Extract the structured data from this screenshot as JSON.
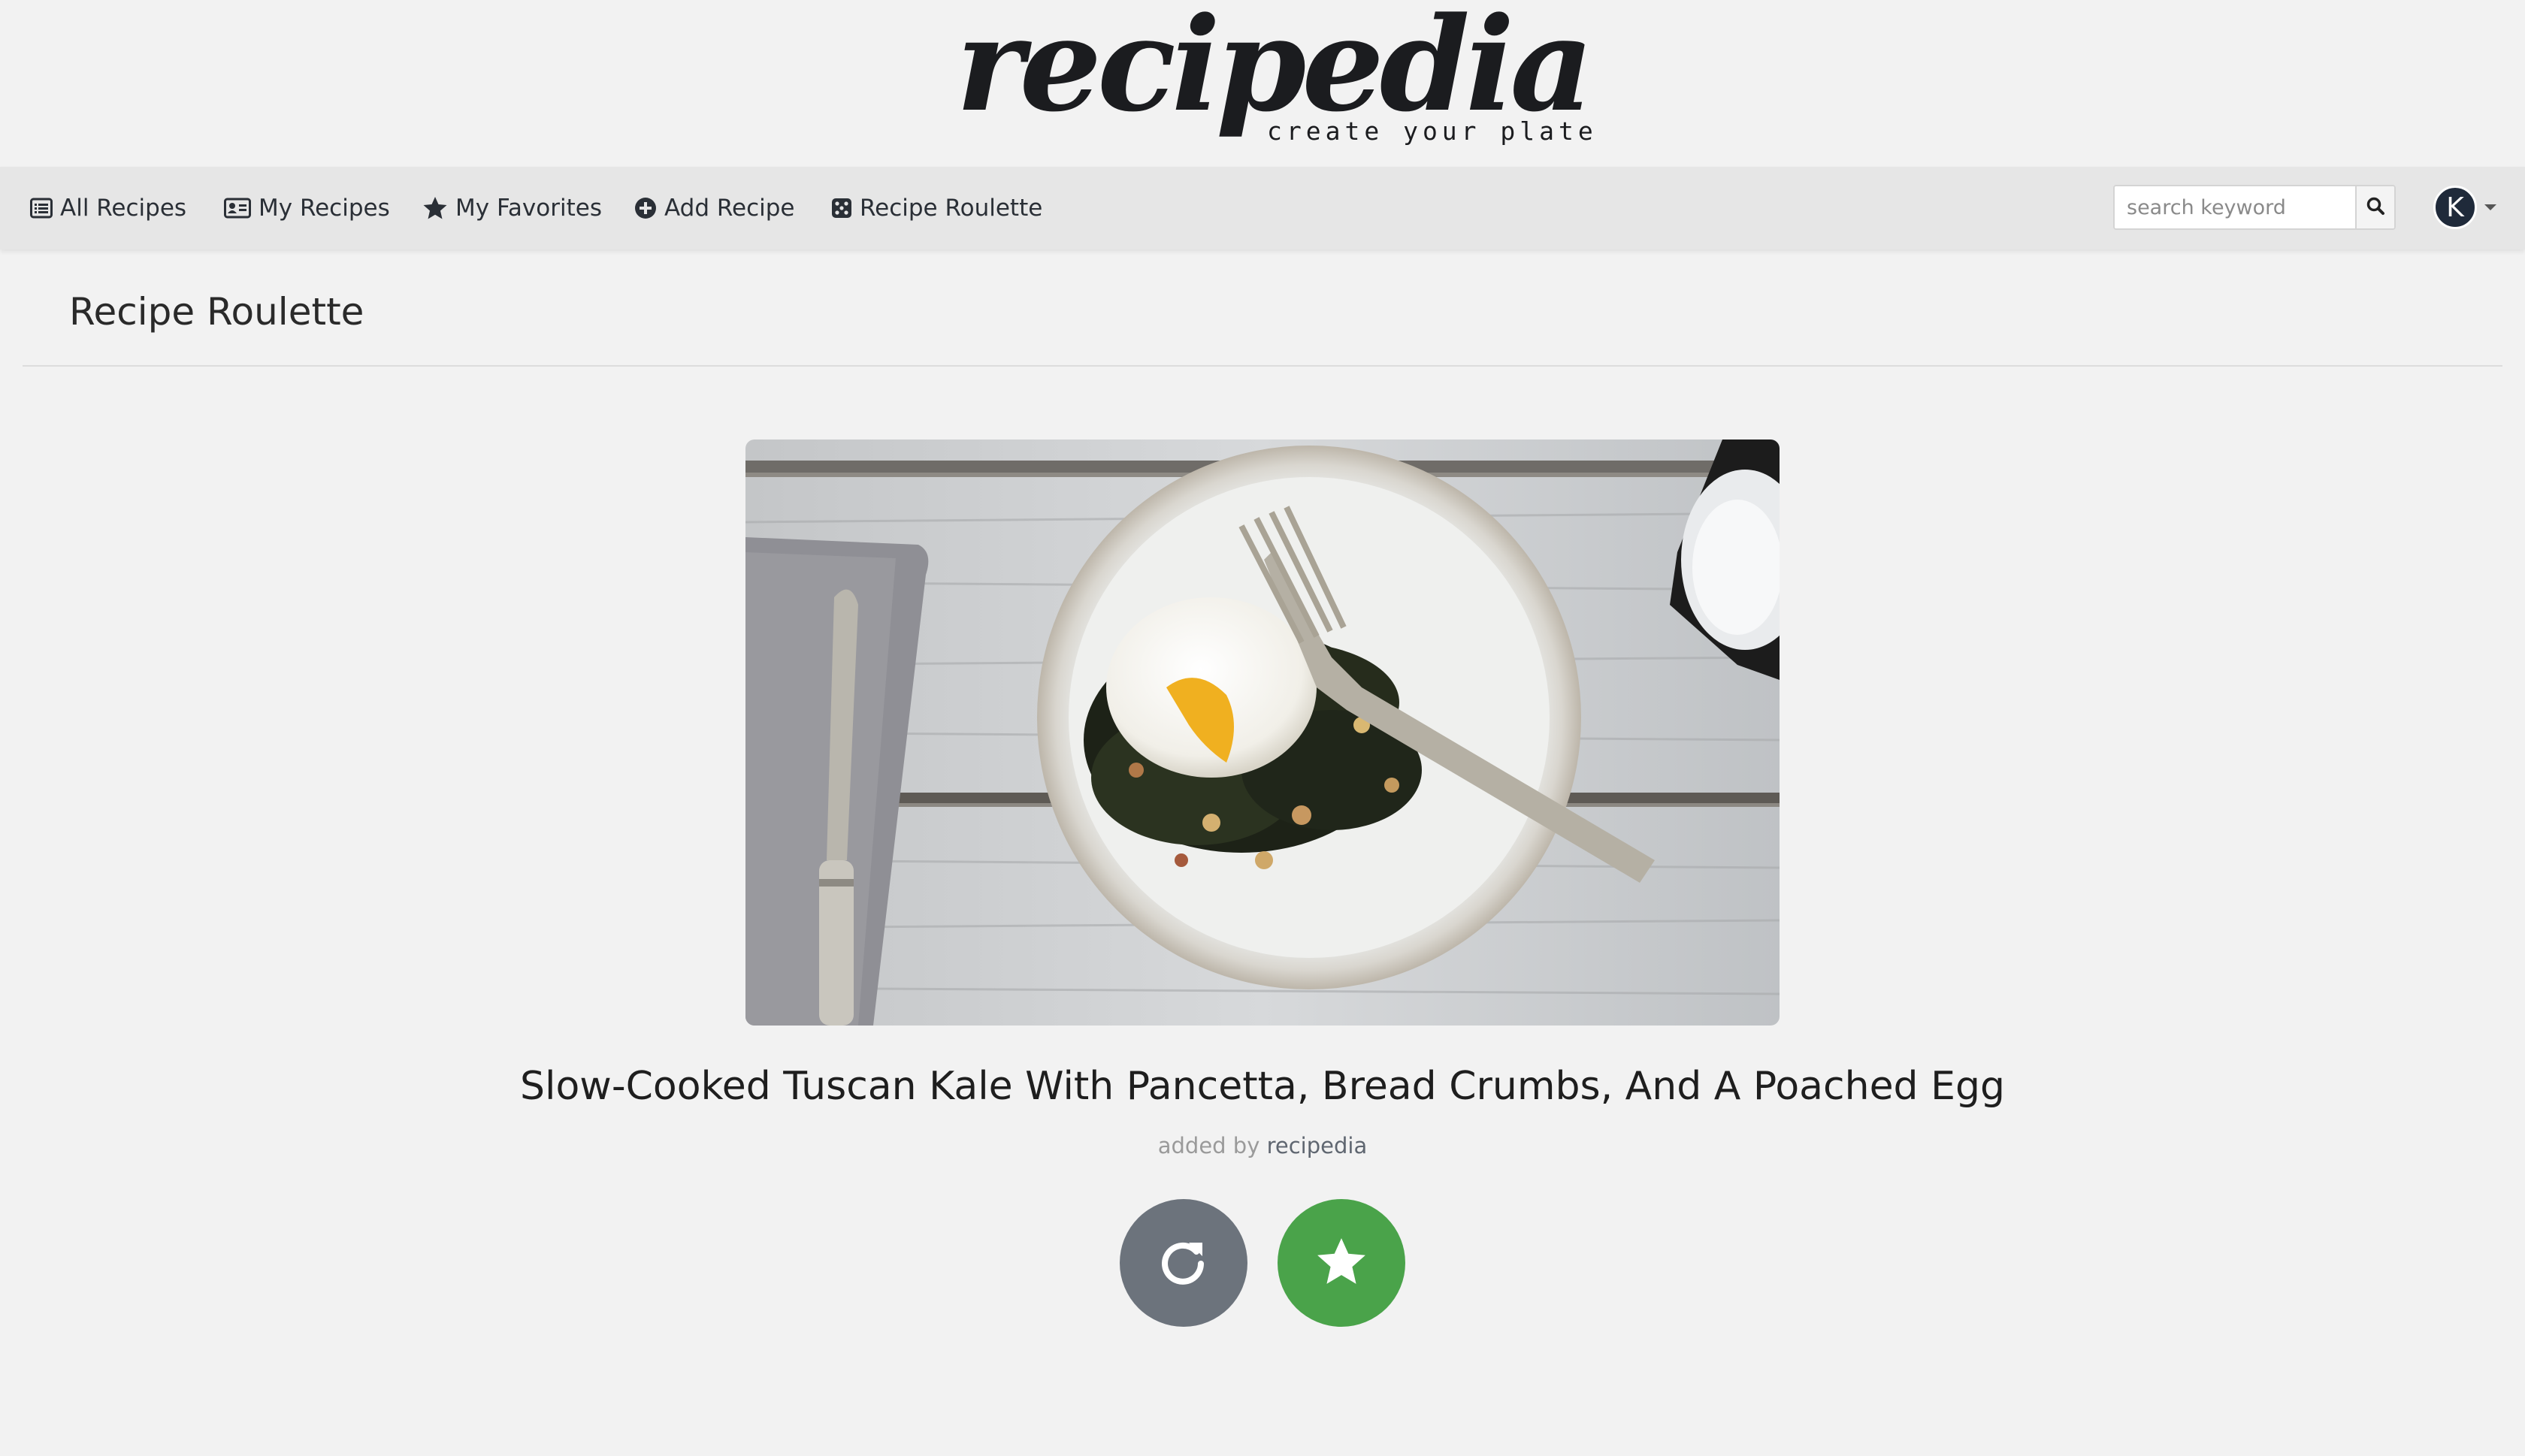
{
  "brand": {
    "logo_text": "recipedia",
    "tagline": "create your plate"
  },
  "nav": {
    "items": [
      {
        "label": "All Recipes",
        "icon": "list-icon"
      },
      {
        "label": "My Recipes",
        "icon": "id-card-icon"
      },
      {
        "label": "My Favorites",
        "icon": "star-icon"
      },
      {
        "label": "Add Recipe",
        "icon": "plus-circle-icon"
      },
      {
        "label": "Recipe Roulette",
        "icon": "dice-icon"
      }
    ],
    "search": {
      "placeholder": "search keyword",
      "value": ""
    },
    "user": {
      "initial": "K"
    }
  },
  "page": {
    "title": "Recipe Roulette"
  },
  "recipe": {
    "name": "Slow-Cooked Tuscan Kale With Pancetta, Bread Crumbs, And A Poached Egg",
    "added_by_prefix": "added by",
    "author": "recipedia"
  },
  "actions": {
    "refresh_icon": "refresh-icon",
    "favorite_icon": "star-icon"
  },
  "colors": {
    "background": "#f2f2f2",
    "navbar": "#e6e6e6",
    "refresh_button": "#6c737c",
    "favorite_button": "#4aa34a",
    "avatar": "#1f2a3a"
  }
}
